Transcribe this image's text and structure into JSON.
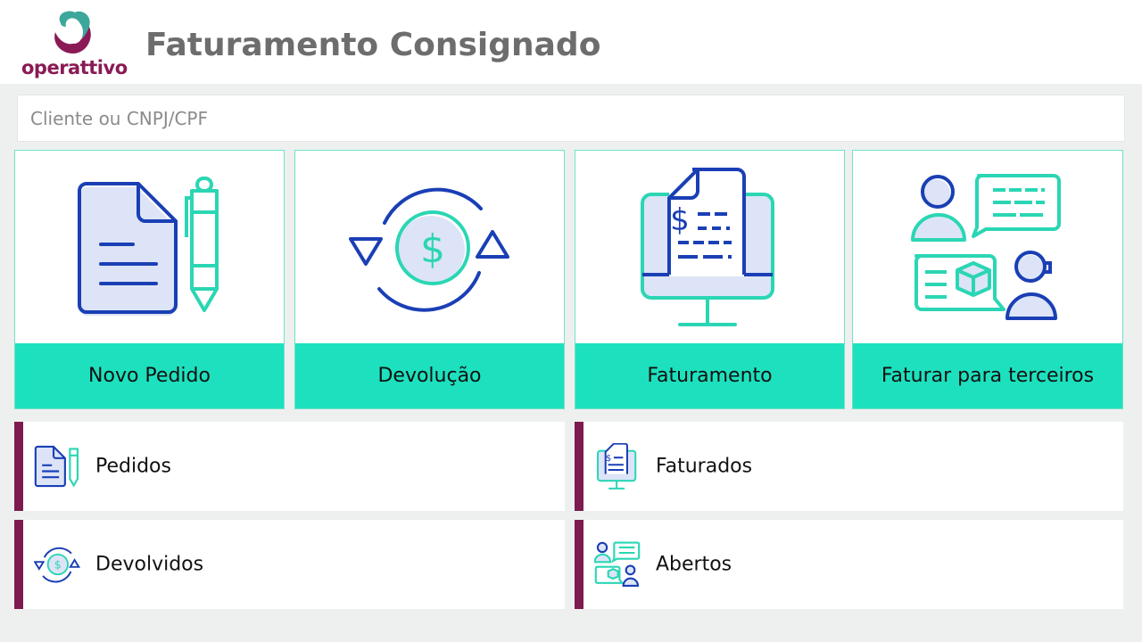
{
  "app": {
    "logo_text": "operattivo",
    "title": "Faturamento Consignado"
  },
  "search": {
    "placeholder": "Cliente ou CNPJ/CPF",
    "value": ""
  },
  "tiles": [
    {
      "label": "Novo Pedido",
      "icon": "document-pen-icon"
    },
    {
      "label": "Devolução",
      "icon": "money-return-icon"
    },
    {
      "label": "Faturamento",
      "icon": "invoice-monitor-icon"
    },
    {
      "label": "Faturar para terceiros",
      "icon": "third-party-chat-icon"
    }
  ],
  "lists": [
    {
      "label": "Pedidos",
      "icon": "document-pen-icon"
    },
    {
      "label": "Faturados",
      "icon": "invoice-monitor-icon"
    },
    {
      "label": "Devolvidos",
      "icon": "money-return-icon"
    },
    {
      "label": "Abertos",
      "icon": "third-party-chat-icon"
    }
  ],
  "colors": {
    "accent": "#1de1be",
    "brand": "#7d1a4f",
    "icon_blue": "#1a3fb5",
    "icon_teal": "#2bd6b4"
  }
}
